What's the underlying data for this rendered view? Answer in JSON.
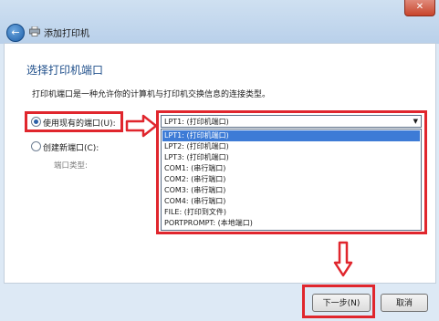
{
  "window": {
    "title": "添加打印机",
    "close_glyph": "✕",
    "back_glyph": "←"
  },
  "page": {
    "heading": "选择打印机端口",
    "description": "打印机端口是一种允许你的计算机与打印机交换信息的连接类型。"
  },
  "options": {
    "use_existing_label": "使用现有的端口(U):",
    "use_existing_selected": true,
    "create_new_label": "创建新端口(C):",
    "create_new_selected": false,
    "port_type_label": "端口类型:"
  },
  "port_dropdown": {
    "selected_value": "LPT1: (打印机端口)",
    "arrow_glyph": "▼",
    "items": [
      "LPT1: (打印机端口)",
      "LPT2: (打印机端口)",
      "LPT3: (打印机端口)",
      "COM1: (串行端口)",
      "COM2: (串行端口)",
      "COM3: (串行端口)",
      "COM4: (串行端口)",
      "FILE: (打印到文件)",
      "PORTPROMPT: (本地端口)"
    ],
    "highlighted_index": 0
  },
  "buttons": {
    "next": "下一步(N)",
    "cancel": "取消"
  },
  "colors": {
    "annotation": "#e0262d",
    "heading": "#1e4e8a",
    "highlight": "#3d7bd6"
  },
  "icons": {
    "back": "back-arrow-icon",
    "printer": "printer-icon",
    "close": "close-icon"
  }
}
